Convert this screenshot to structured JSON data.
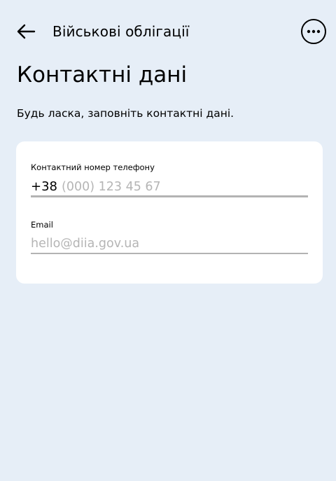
{
  "header": {
    "title": "Військові облігації",
    "back_icon": "arrow-left-icon",
    "more_icon": "more-horizontal-icon"
  },
  "page": {
    "title": "Контактні дані",
    "subtitle": "Будь ласка, заповніть контактні дані."
  },
  "form": {
    "phone": {
      "label": "Контактний номер телефону",
      "prefix": "+38",
      "placeholder": "(000) 123 45 67",
      "value": ""
    },
    "email": {
      "label": "Email",
      "placeholder": "hello@diia.gov.ua",
      "value": ""
    }
  },
  "colors": {
    "background": "#e6eef7",
    "card": "#ffffff",
    "placeholder": "#b5b5b5",
    "underline": "#b3b3b3"
  }
}
